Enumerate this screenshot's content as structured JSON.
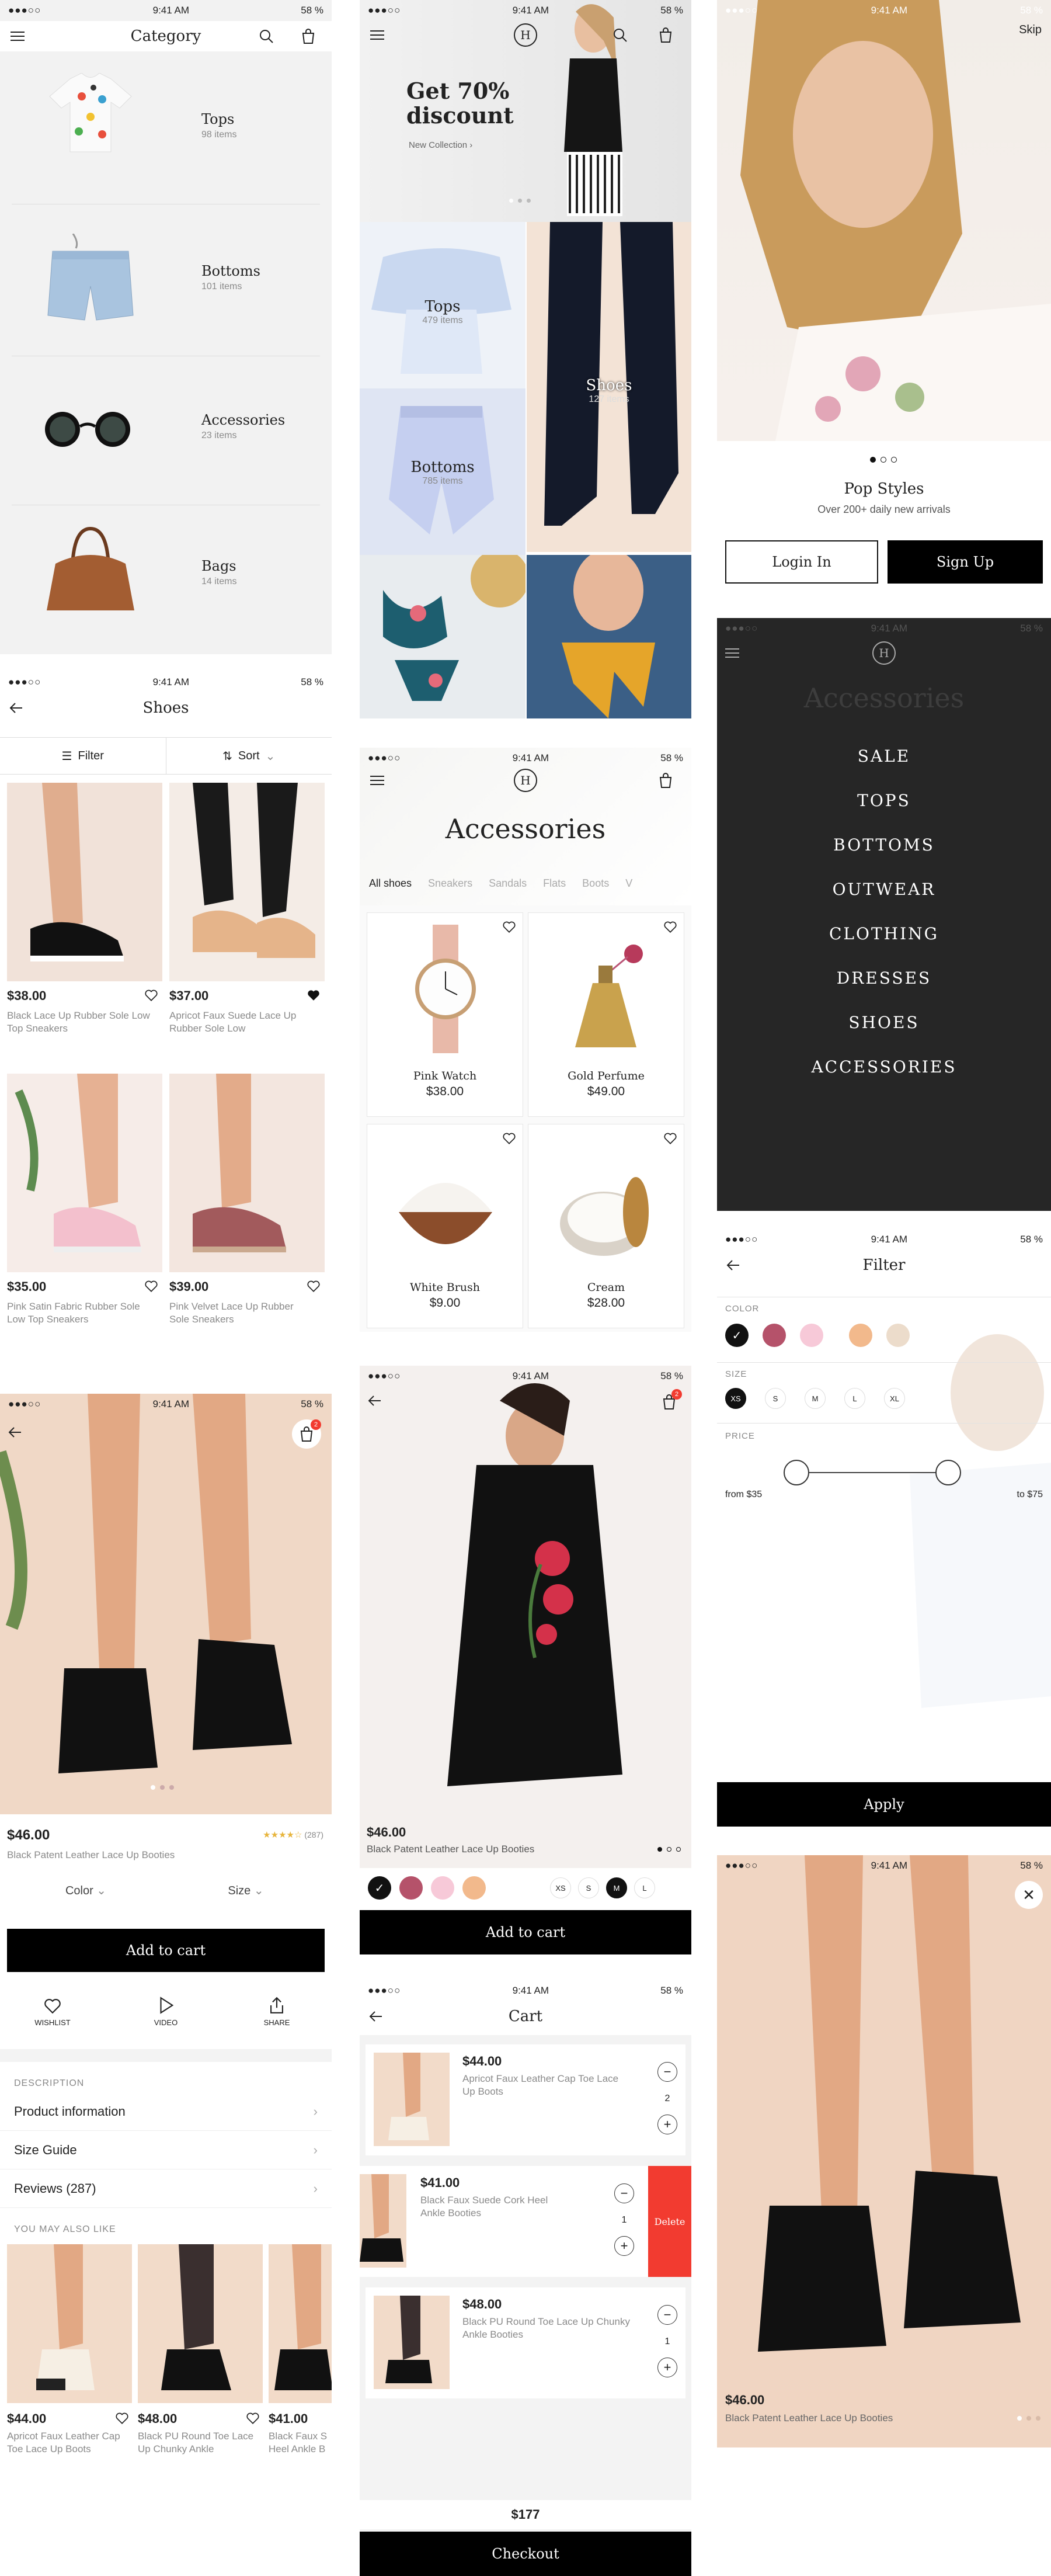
{
  "status": {
    "time": "9:41 AM",
    "battery": "58 %",
    "signal": "●●●○○"
  },
  "colors": {
    "accent_red": "#f23b30",
    "black": "#000000",
    "bg_light": "#f3f3f3"
  },
  "category": {
    "title": "Category",
    "items": [
      {
        "name": "Tops",
        "count": "98 items"
      },
      {
        "name": "Bottoms",
        "count": "101 items"
      },
      {
        "name": "Accessories",
        "count": "23 items"
      },
      {
        "name": "Bags",
        "count": "14 items"
      }
    ]
  },
  "home": {
    "hero_title_1": "Get 70%",
    "hero_title_2": "discount",
    "hero_link": "New Collection",
    "tiles": [
      {
        "name": "Tops",
        "count": "479 items"
      },
      {
        "name": "Shoes",
        "count": "127 items"
      },
      {
        "name": "Bottoms",
        "count": "785 items"
      }
    ]
  },
  "onboarding": {
    "skip": "Skip",
    "title": "Pop Styles",
    "subtitle": "Over 200+ daily new arrivals",
    "login": "Login In",
    "signup": "Sign Up"
  },
  "shoes": {
    "title": "Shoes",
    "filter": "Filter",
    "sort": "Sort",
    "products": [
      {
        "price": "$38.00",
        "name": "Black Lace Up Rubber Sole Low Top Sneakers"
      },
      {
        "price": "$37.00",
        "name": "Apricot Faux Suede Lace Up Rubber Sole Low"
      },
      {
        "price": "$35.00",
        "name": "Pink Satin Fabric Rubber Sole Low Top Sneakers"
      },
      {
        "price": "$39.00",
        "name": "Pink Velvet Lace Up Rubber Sole Sneakers"
      }
    ]
  },
  "accessories": {
    "title": "Accessories",
    "tabs": [
      "All shoes",
      "Sneakers",
      "Sandals",
      "Flats",
      "Boots",
      "V"
    ],
    "products": [
      {
        "name": "Pink Watch",
        "price": "$38.00"
      },
      {
        "name": "Gold Perfume",
        "price": "$49.00"
      },
      {
        "name": "White Brush",
        "price": "$9.00"
      },
      {
        "name": "Cream",
        "price": "$28.00"
      }
    ]
  },
  "menu": {
    "bg_title": "Accessories",
    "items": [
      "SALE",
      "TOPS",
      "BOTTOMS",
      "OUTWEAR",
      "CLOTHING",
      "DRESSES",
      "SHOES",
      "ACCESSORIES"
    ]
  },
  "product": {
    "price": "$46.00",
    "name": "Black Patent Leather Lace Up Booties",
    "rating_count": "(287)",
    "rating": 4,
    "cart_badge": "2",
    "color_label": "Color",
    "size_label": "Size",
    "add_to_cart": "Add to cart",
    "actions": [
      "WISHLIST",
      "VIDEO",
      "SHARE"
    ],
    "description_header": "DESCRIPTION",
    "rows": [
      "Product information",
      "Size Guide",
      "Reviews (287)"
    ],
    "also_like_header": "YOU MAY ALSO LIKE",
    "also_like": [
      {
        "price": "$44.00",
        "name": "Apricot Faux Leather Cap Toe Lace Up Boots"
      },
      {
        "price": "$48.00",
        "name": "Black PU Round Toe Lace Up Chunky Ankle"
      },
      {
        "price": "$41.00",
        "name": "Black Faux S Heel Ankle B"
      }
    ]
  },
  "dress": {
    "price": "$46.00",
    "name": "Black Patent Leather Lace Up Booties",
    "cart_badge": "2",
    "colors": [
      "#111111",
      "#b5526a",
      "#f7c9d8",
      "#f2b98c"
    ],
    "sizes": [
      "XS",
      "S",
      "M",
      "L"
    ],
    "selected_size": "M",
    "add_to_cart": "Add to cart"
  },
  "cart": {
    "title": "Cart",
    "items": [
      {
        "price": "$44.00",
        "name": "Apricot Faux Leather Cap Toe Lace Up Boots",
        "qty": "2"
      },
      {
        "price": "$41.00",
        "name": "Black Faux Suede Cork Heel Ankle Booties",
        "qty": "1"
      },
      {
        "price": "$48.00",
        "name": "Black PU Round Toe Lace Up Chunky Ankle Booties",
        "qty": "1"
      }
    ],
    "delete": "Delete",
    "total": "$177",
    "checkout": "Checkout"
  },
  "filter": {
    "title": "Filter",
    "color_label": "COLOR",
    "colors": [
      "#111111",
      "#b5526a",
      "#f7c9d8",
      "#f2b98c",
      "#ecdccb"
    ],
    "size_label": "SIZE",
    "sizes": [
      "XS",
      "S",
      "M",
      "L",
      "XL"
    ],
    "price_label": "PRICE",
    "from": "from $35",
    "to": "to $75",
    "apply": "Apply"
  },
  "boots_view": {
    "price": "$46.00",
    "name": "Black Patent Leather Lace Up Booties"
  }
}
